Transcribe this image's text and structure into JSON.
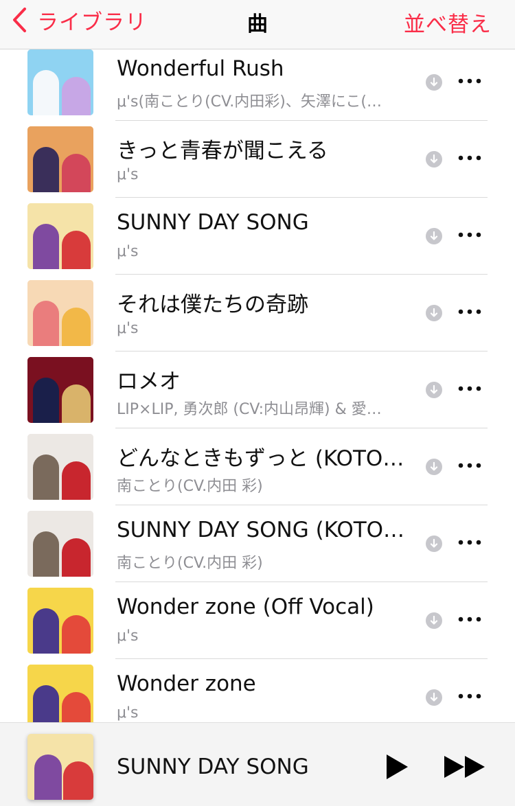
{
  "nav": {
    "back_label": "ライブラリ",
    "title": "曲",
    "sort_label": "並べ替え",
    "accent_color": "#fa2d48"
  },
  "songs": [
    {
      "title": "Wonderful Rush",
      "artist": "μ's(南ことり(CV.内田彩)、矢澤にこ(…",
      "art": [
        "#8fd3f2",
        "#f4f8fb",
        "#c7a7e6"
      ]
    },
    {
      "title": "きっと青春が聞こえる",
      "artist": "μ's",
      "art": [
        "#e9a25e",
        "#3a2f5a",
        "#d3475a"
      ]
    },
    {
      "title": "SUNNY DAY SONG",
      "artist": "μ's",
      "art": [
        "#f5e3a8",
        "#7f4aa0",
        "#d83b3b"
      ]
    },
    {
      "title": "それは僕たちの奇跡",
      "artist": "μ's",
      "art": [
        "#f7d9b5",
        "#ea7d7d",
        "#f2b848"
      ]
    },
    {
      "title": "ロメオ",
      "artist": "LIP×LIP, 勇次郎 (CV:内山昂輝) & 愛…",
      "art": [
        "#7a1020",
        "#1a1f4a",
        "#d9b36a"
      ]
    },
    {
      "title": "どんなときもずっと (KOTO…",
      "artist": "南ことり(CV.内田 彩)",
      "art": [
        "#ece8e4",
        "#7a6a5c",
        "#c8262e"
      ]
    },
    {
      "title": "SUNNY DAY SONG (KOTO…",
      "artist": "南ことり(CV.内田 彩)",
      "art": [
        "#ece8e4",
        "#7a6a5c",
        "#c8262e"
      ]
    },
    {
      "title": "Wonder zone (Off Vocal)",
      "artist": "μ's",
      "art": [
        "#f6d64a",
        "#4a3a8a",
        "#e44a3a"
      ]
    },
    {
      "title": "Wonder zone",
      "artist": "μ's",
      "art": [
        "#f6d64a",
        "#4a3a8a",
        "#e44a3a"
      ]
    }
  ],
  "icons": {
    "download": "download-cloud-icon",
    "more": "ellipsis-icon",
    "play": "play-icon",
    "forward": "fast-forward-icon"
  },
  "now_playing": {
    "title": "SUNNY DAY SONG",
    "art": [
      "#f5e3a8",
      "#7f4aa0",
      "#d83b3b"
    ]
  }
}
